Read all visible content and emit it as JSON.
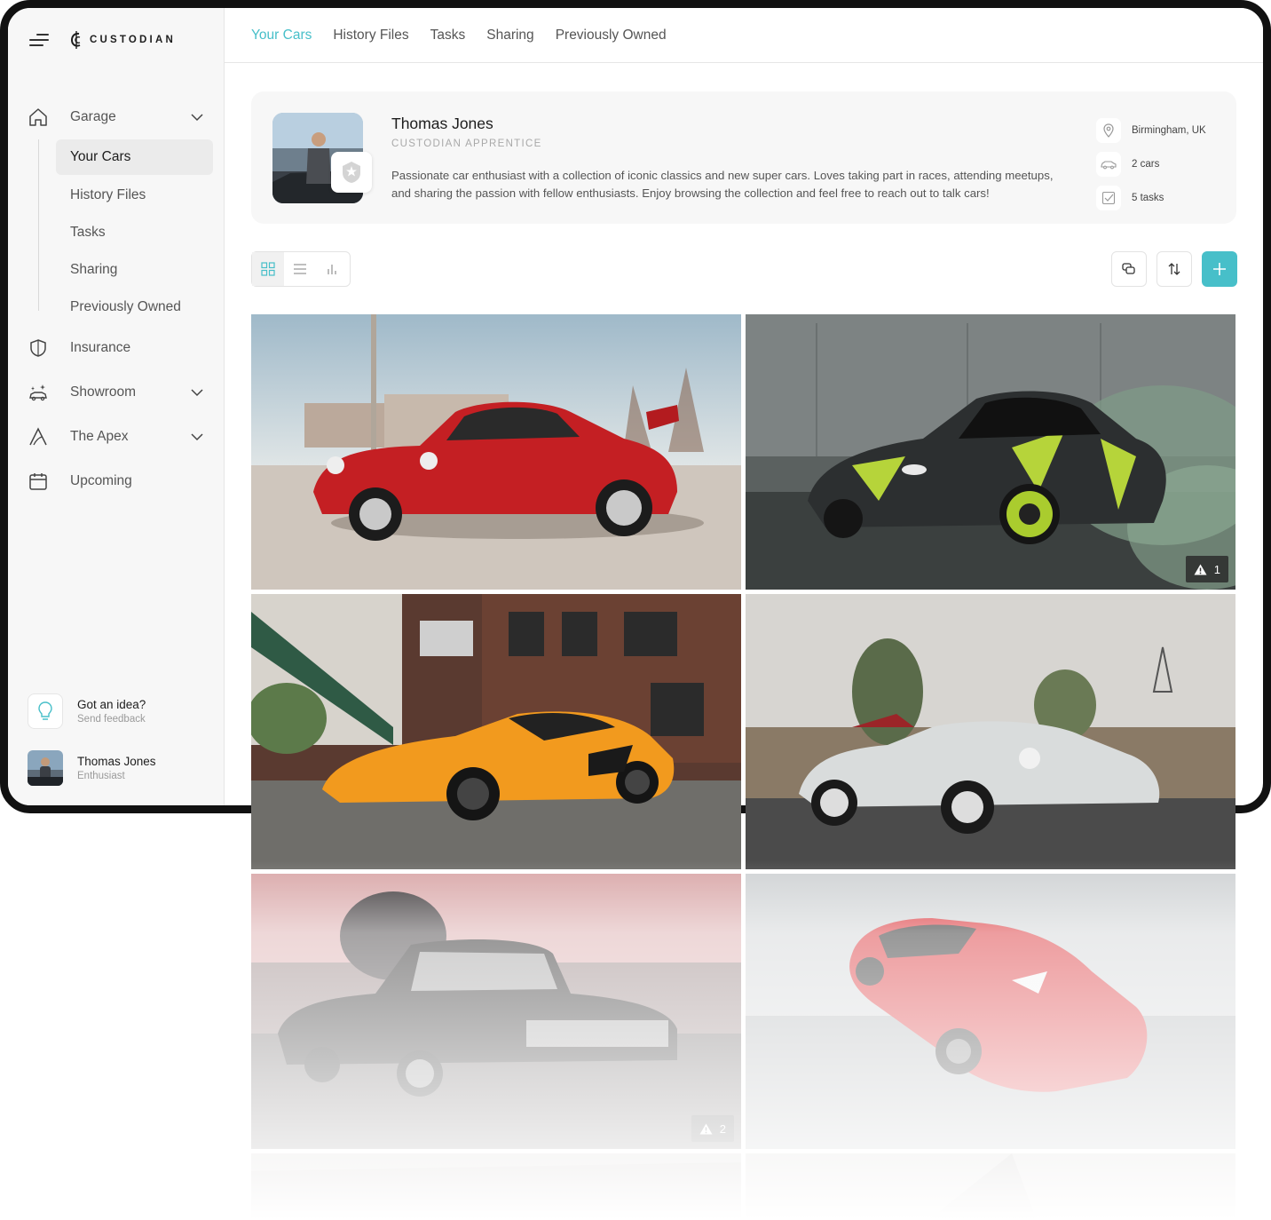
{
  "brand": {
    "name": "CUSTODIAN"
  },
  "colors": {
    "accent": "#47bfc9",
    "sidebar_bg": "#f7f7f7",
    "frame": "#111111"
  },
  "sidebar": {
    "items": [
      {
        "label": "Garage",
        "icon": "home-icon",
        "expandable": true,
        "expanded": true,
        "children": [
          {
            "label": "Your Cars",
            "active": true
          },
          {
            "label": "History Files"
          },
          {
            "label": "Tasks"
          },
          {
            "label": "Sharing"
          },
          {
            "label": "Previously Owned"
          }
        ]
      },
      {
        "label": "Insurance",
        "icon": "shield-icon"
      },
      {
        "label": "Showroom",
        "icon": "sparkle-car-icon",
        "expandable": true
      },
      {
        "label": "The Apex",
        "icon": "road-icon",
        "expandable": true
      },
      {
        "label": "Upcoming",
        "icon": "calendar-icon"
      }
    ],
    "feedback": {
      "title": "Got an idea?",
      "subtitle": "Send feedback",
      "icon": "lightbulb-icon"
    },
    "user": {
      "name": "Thomas Jones",
      "role": "Enthusiast"
    }
  },
  "tabs": [
    {
      "label": "Your Cars",
      "active": true
    },
    {
      "label": "History Files"
    },
    {
      "label": "Tasks"
    },
    {
      "label": "Sharing"
    },
    {
      "label": "Previously Owned"
    }
  ],
  "profile": {
    "name": "Thomas Jones",
    "title": "CUSTODIAN APPRENTICE",
    "bio": "Passionate car enthusiast with a collection of iconic classics and new super cars. Loves taking part in races, attending meetups, and sharing the passion with fellow enthusiasts. Enjoy browsing the collection and feel free to reach out to talk cars!",
    "stats": [
      {
        "icon": "location-pin-icon",
        "text": "Birmingham, UK"
      },
      {
        "icon": "car-icon",
        "text": "2 cars"
      },
      {
        "icon": "checklist-icon",
        "text": "5 tasks"
      }
    ]
  },
  "toolbar": {
    "views": [
      "grid-view-icon",
      "list-view-icon",
      "chart-view-icon"
    ],
    "active_view": "grid-view-icon",
    "actions": [
      "copy-icon",
      "sort-icon",
      "plus-icon"
    ]
  },
  "cars": [
    {
      "name": "red-911",
      "warning": null
    },
    {
      "name": "camo-gtr",
      "warning": "1"
    },
    {
      "name": "orange-mclaren",
      "warning": null
    },
    {
      "name": "white-speedster",
      "warning": null
    },
    {
      "name": "black-impala",
      "warning": "2"
    },
    {
      "name": "red-ferrari",
      "warning": null
    }
  ]
}
